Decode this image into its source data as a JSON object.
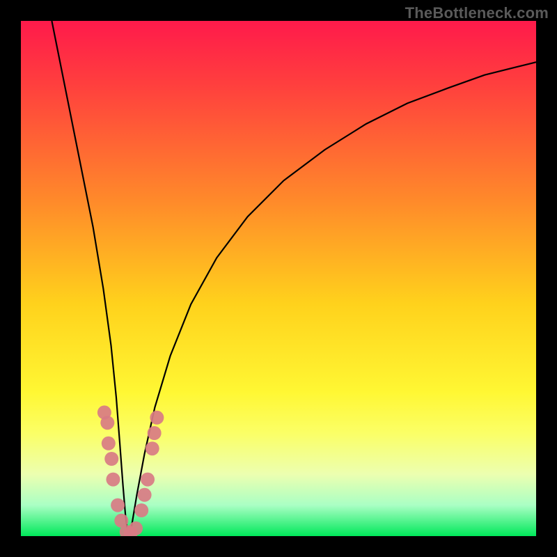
{
  "watermark": "TheBottleneck.com",
  "chart_data": {
    "type": "line",
    "title": "",
    "xlabel": "",
    "ylabel": "",
    "xlim": [
      0,
      100
    ],
    "ylim": [
      0,
      100
    ],
    "gradient_stops": [
      {
        "offset": 0,
        "color": "#ff1a4b"
      },
      {
        "offset": 12,
        "color": "#ff3e3e"
      },
      {
        "offset": 35,
        "color": "#ff8a2a"
      },
      {
        "offset": 55,
        "color": "#ffd21c"
      },
      {
        "offset": 72,
        "color": "#fff733"
      },
      {
        "offset": 80,
        "color": "#fbff66"
      },
      {
        "offset": 88,
        "color": "#ecffb0"
      },
      {
        "offset": 94,
        "color": "#aaffc4"
      },
      {
        "offset": 100,
        "color": "#00e85a"
      }
    ],
    "series": [
      {
        "name": "bottleneck-curve",
        "x": [
          6,
          8,
          10,
          12,
          14,
          16,
          17.5,
          18.5,
          19.2,
          19.8,
          20.3,
          20.8,
          21.5,
          22.5,
          24,
          26,
          29,
          33,
          38,
          44,
          51,
          59,
          67,
          75,
          83,
          90,
          96,
          100
        ],
        "y": [
          100,
          90,
          80,
          70,
          60,
          48,
          37,
          27,
          18,
          10,
          4,
          0,
          2,
          8,
          16,
          25,
          35,
          45,
          54,
          62,
          69,
          75,
          80,
          84,
          87,
          89.5,
          91,
          92
        ]
      }
    ],
    "markers": {
      "name": "sample-points",
      "color": "#d87b84",
      "radius": 10,
      "points": [
        {
          "x": 16.2,
          "y": 24
        },
        {
          "x": 16.8,
          "y": 22
        },
        {
          "x": 17.0,
          "y": 18
        },
        {
          "x": 17.6,
          "y": 15
        },
        {
          "x": 17.9,
          "y": 11
        },
        {
          "x": 18.8,
          "y": 6
        },
        {
          "x": 19.5,
          "y": 3
        },
        {
          "x": 20.5,
          "y": 0.8
        },
        {
          "x": 21.3,
          "y": 0.6
        },
        {
          "x": 22.3,
          "y": 1.5
        },
        {
          "x": 23.4,
          "y": 5
        },
        {
          "x": 24.0,
          "y": 8
        },
        {
          "x": 24.6,
          "y": 11
        },
        {
          "x": 25.5,
          "y": 17
        },
        {
          "x": 25.9,
          "y": 20
        },
        {
          "x": 26.4,
          "y": 23
        }
      ]
    }
  }
}
